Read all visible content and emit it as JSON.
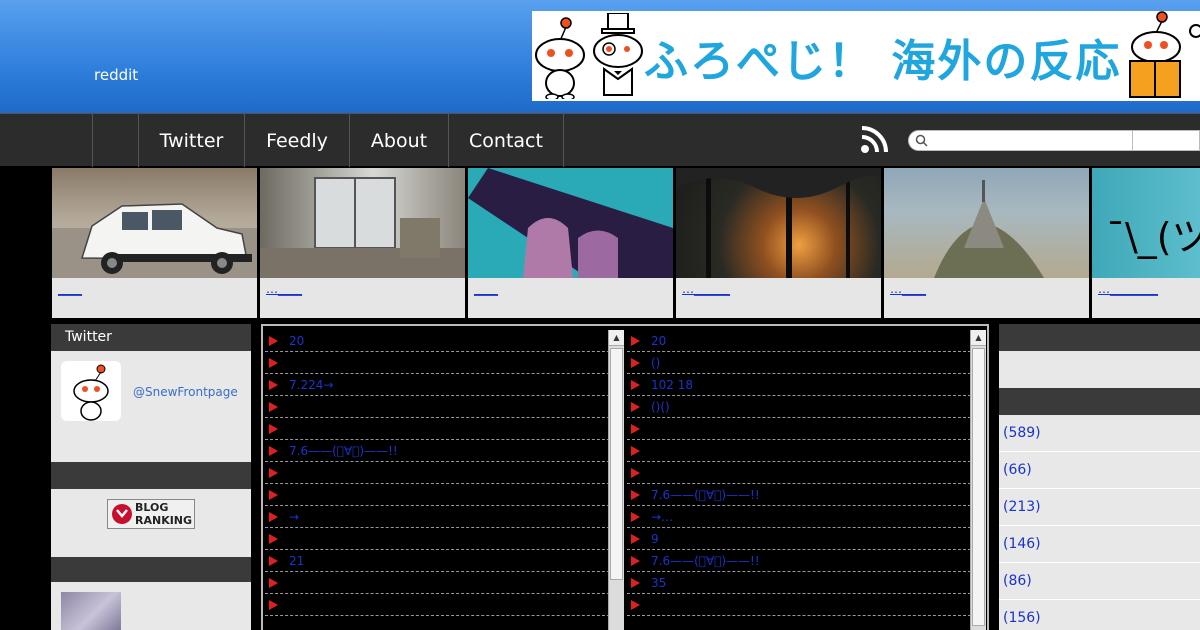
{
  "header": {
    "site_name": "reddit",
    "banner_text": "ふろぺじ！ 海外の反応"
  },
  "nav": {
    "items": [
      {
        "label": ""
      },
      {
        "label": "Twitter"
      },
      {
        "label": "Feedly"
      },
      {
        "label": "About"
      },
      {
        "label": "Contact"
      }
    ],
    "search": {
      "placeholder": "",
      "value": ""
    },
    "rss_icon": "rss-icon"
  },
  "featured": [
    {
      "caption": "____",
      "thumb": "white-car"
    },
    {
      "caption": "…____",
      "thumb": "room-after-earthquake"
    },
    {
      "caption": "____",
      "thumb": "purple-ice-cream"
    },
    {
      "caption": "…______",
      "thumb": "forest-fire"
    },
    {
      "caption": "…____",
      "thumb": "mont-saint-michel"
    },
    {
      "caption": "…________",
      "thumb": "shrug-emoticon"
    }
  ],
  "sidebar_left": {
    "twitter_panel_title": "Twitter",
    "twitter_handle": "@SnewFrontpage",
    "panel2_title": "",
    "blog_ranking_label_1": "BLOG",
    "blog_ranking_label_2": "RANKING",
    "panel3_title": ""
  },
  "center": {
    "left_list": [
      "20",
      "",
      "7.224→",
      "",
      "",
      "7.6——(ﾟ∀ﾟ)——!!",
      "",
      "",
      "→",
      "",
      "21",
      "",
      ""
    ],
    "right_list": [
      "20",
      "()",
      "102 18",
      "()()",
      "",
      "",
      "",
      "7.6——(ﾟ∀ﾟ)——!!",
      "→…",
      "9",
      "7.6——(ﾟ∀ﾟ)——!!",
      "35",
      ""
    ]
  },
  "sidebar_right": {
    "top_header": "",
    "second_header": "",
    "categories": [
      "(589)",
      "(66)",
      "(213)",
      "(146)",
      "(86)",
      "(156)"
    ]
  },
  "colors": {
    "header_blue": "#2f7fdc",
    "nav_bg": "#2c2c2c",
    "link_blue": "#1a33cc",
    "arrow_red": "#e02020"
  }
}
